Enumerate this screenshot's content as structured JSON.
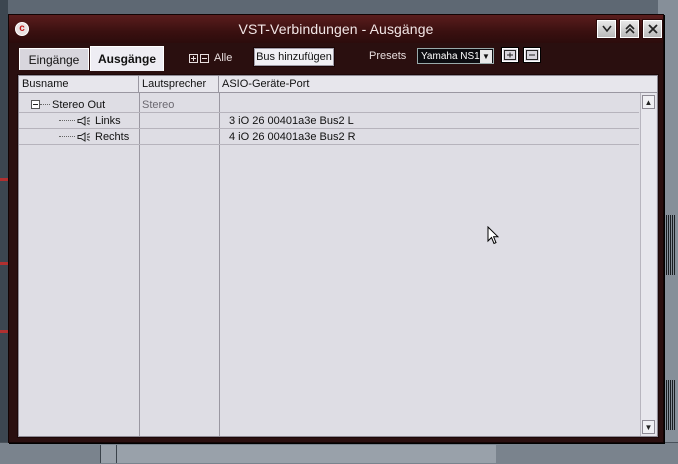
{
  "window": {
    "title": "VST-Verbindungen - Ausgänge",
    "controls": [
      "minimize-icon",
      "maximize-icon",
      "close-icon"
    ]
  },
  "tabs": [
    {
      "label": "Eingänge",
      "active": false
    },
    {
      "label": "Ausgänge",
      "active": true
    }
  ],
  "toolbar": {
    "all_label": "Alle",
    "add_bus_label": "Bus hinzufügen",
    "presets_label": "Presets",
    "preset_value": "Yamaha NS1",
    "preset_icons": [
      "store-preset-icon",
      "remove-preset-icon"
    ]
  },
  "table": {
    "columns": [
      "Busname",
      "Lautsprecher",
      "ASIO-Geräte-Port"
    ],
    "rows": [
      {
        "name": "Stereo Out",
        "speaker": "Stereo",
        "port": "",
        "level": 0,
        "expanded": true
      },
      {
        "name": "Links",
        "speaker": "",
        "port": "3 iO 26 00401a3e Bus2 L",
        "level": 1
      },
      {
        "name": "Rechts",
        "speaker": "",
        "port": "4 iO 26 00401a3e Bus2 R",
        "level": 1
      }
    ]
  },
  "colors": {
    "window_frame": "#2a0f0f",
    "titlebar": "#3a1010",
    "panel_bg": "#dedde4",
    "accent_red": "#c01818"
  }
}
